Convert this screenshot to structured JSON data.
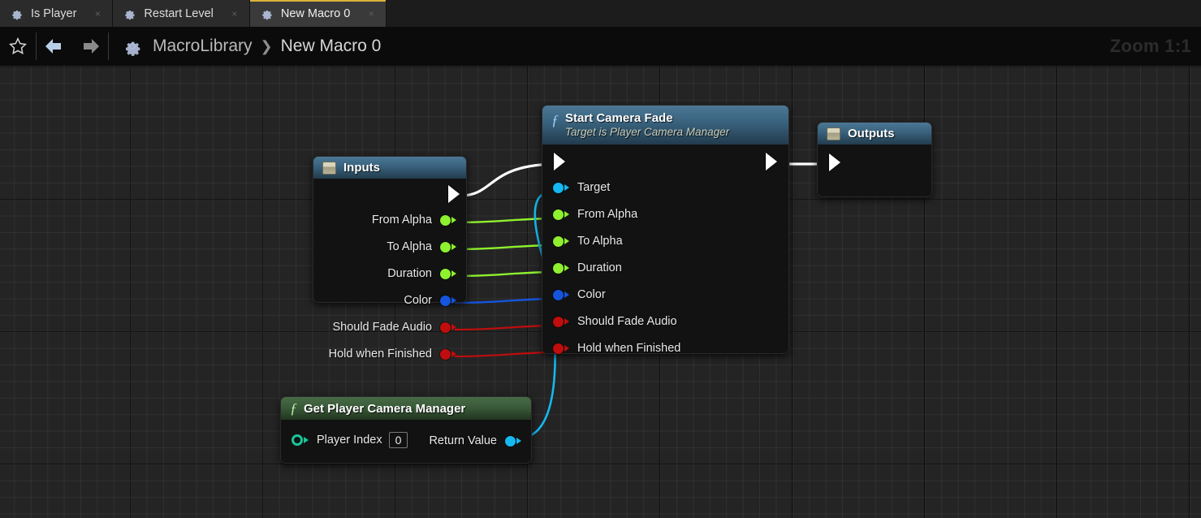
{
  "tabs": [
    {
      "label": "Is Player",
      "icon": "gear-icon",
      "active": false,
      "close": "×"
    },
    {
      "label": "Restart Level",
      "icon": "gear-icon",
      "active": false,
      "close": "×"
    },
    {
      "label": "New Macro 0",
      "icon": "gear-icon",
      "active": true,
      "close": "×"
    }
  ],
  "toolbar": {
    "favorite_icon": "star-icon",
    "back_icon": "arrow-left-icon",
    "forward_icon": "arrow-right-icon",
    "breadcrumb_icon": "gear-icon",
    "breadcrumb": [
      "MacroLibrary",
      "New Macro 0"
    ],
    "breadcrumb_separator": "❯",
    "zoom_label": "Zoom 1:1"
  },
  "graph": {
    "nodes": {
      "inputs": {
        "title": "Inputs",
        "icon": "tunnel-box-icon",
        "exec_out": "exec-pin",
        "pins": [
          {
            "label": "From Alpha",
            "color": "green"
          },
          {
            "label": "To Alpha",
            "color": "green"
          },
          {
            "label": "Duration",
            "color": "green"
          },
          {
            "label": "Color",
            "color": "blue"
          },
          {
            "label": "Should Fade Audio",
            "color": "red"
          },
          {
            "label": "Hold when Finished",
            "color": "red"
          }
        ]
      },
      "start_camera_fade": {
        "title": "Start Camera Fade",
        "subtitle": "Target is Player Camera Manager",
        "icon": "function-icon",
        "exec_in": "exec-pin",
        "exec_out": "exec-pin",
        "pins": [
          {
            "label": "Target",
            "color": "cyan"
          },
          {
            "label": "From Alpha",
            "color": "green"
          },
          {
            "label": "To Alpha",
            "color": "green"
          },
          {
            "label": "Duration",
            "color": "green"
          },
          {
            "label": "Color",
            "color": "blue"
          },
          {
            "label": "Should Fade Audio",
            "color": "red"
          },
          {
            "label": "Hold when Finished",
            "color": "red"
          }
        ]
      },
      "outputs": {
        "title": "Outputs",
        "icon": "tunnel-box-icon",
        "exec_in": "exec-pin"
      },
      "get_player_camera_manager": {
        "title": "Get Player Camera Manager",
        "icon": "function-icon",
        "input_pin_label": "Player Index",
        "input_pin_value": "0",
        "output_pin_label": "Return Value"
      }
    },
    "colors": {
      "exec_wire": "#ffffff",
      "object_wire": "#15b8f0",
      "float_wire": "#8ef02e",
      "struct_wire": "#1555dd",
      "bool_wire": "#c00d0d",
      "int_pin": "#17c79a",
      "canvas": "#242424",
      "accent_tab": "#d9b23c"
    }
  }
}
